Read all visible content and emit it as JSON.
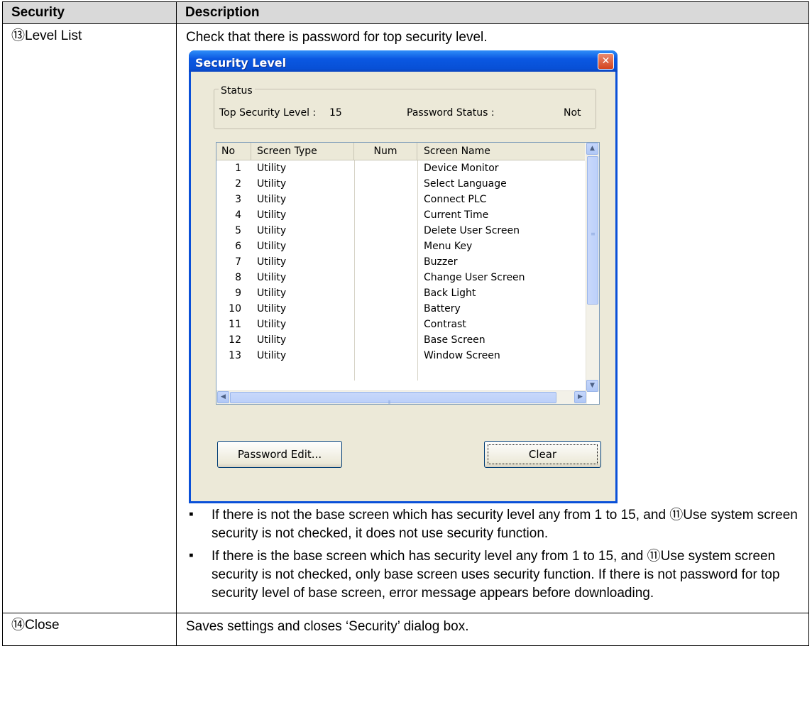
{
  "table": {
    "header": {
      "col1": "Security",
      "col2": "Description"
    },
    "row1": {
      "left": "⑬Level List",
      "intro": "Check that there is password for top security level.",
      "dialog": {
        "title": "Security Level",
        "close_glyph": "✕",
        "status": {
          "legend": "Status",
          "top_level_label": "Top Security Level :",
          "top_level_value": "15",
          "password_label": "Password Status :",
          "password_value": "Not"
        },
        "list": {
          "columns": [
            "No",
            "Screen Type",
            "Num",
            "Screen Name"
          ],
          "rows": [
            {
              "no": "1",
              "type": "Utility",
              "num": "",
              "name": "Device Monitor"
            },
            {
              "no": "2",
              "type": "Utility",
              "num": "",
              "name": "Select Language"
            },
            {
              "no": "3",
              "type": "Utility",
              "num": "",
              "name": "Connect PLC"
            },
            {
              "no": "4",
              "type": "Utility",
              "num": "",
              "name": "Current Time"
            },
            {
              "no": "5",
              "type": "Utility",
              "num": "",
              "name": "Delete User Screen"
            },
            {
              "no": "6",
              "type": "Utility",
              "num": "",
              "name": "Menu Key"
            },
            {
              "no": "7",
              "type": "Utility",
              "num": "",
              "name": "Buzzer"
            },
            {
              "no": "8",
              "type": "Utility",
              "num": "",
              "name": "Change User Screen"
            },
            {
              "no": "9",
              "type": "Utility",
              "num": "",
              "name": "Back Light"
            },
            {
              "no": "10",
              "type": "Utility",
              "num": "",
              "name": "Battery"
            },
            {
              "no": "11",
              "type": "Utility",
              "num": "",
              "name": "Contrast"
            },
            {
              "no": "12",
              "type": "Utility",
              "num": "",
              "name": "Base Screen"
            },
            {
              "no": "13",
              "type": "Utility",
              "num": "",
              "name": "Window Screen"
            }
          ]
        },
        "buttons": {
          "password_edit": "Password Edit...",
          "clear": "Clear"
        }
      },
      "bullets": [
        "If there is not the base screen which has security level any from 1 to 15, and  ⑪Use system screen security is not checked, it does not use security function.",
        "If there is the base screen which has security level any from 1 to 15, and ⑪Use system screen security is not checked, only base screen uses security function. If there is not password for top security level of base screen, error message appears before downloading."
      ],
      "bullet_glyph": "▪"
    },
    "row2": {
      "left": "⑭Close",
      "desc": "Saves settings and closes ‘Security’ dialog box."
    }
  },
  "colors": {
    "title_bar": "#0a58e2",
    "dialog_bg": "#ece9d8",
    "header_bg": "#d9d9d9"
  }
}
